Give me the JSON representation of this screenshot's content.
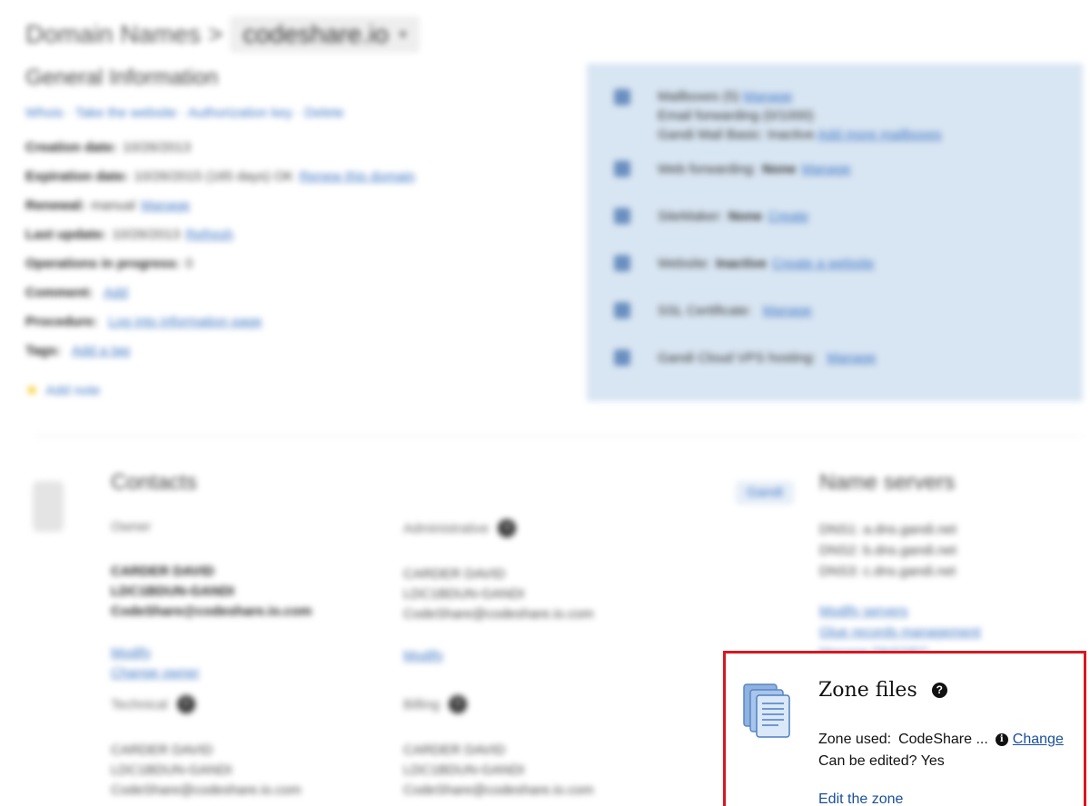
{
  "header": {
    "breadcrumb_root": "Domain Names",
    "breadcrumb_sep": ">",
    "domain": "codeshare.io"
  },
  "general": {
    "title": "General Information",
    "links": "Whois · Take the website · Authorization key · Delete",
    "rows": [
      {
        "key": "Creation date:",
        "value": "10/26/2013",
        "link": ""
      },
      {
        "key": "Expiration date:",
        "value": "10/26/2015 (165 days) OK",
        "link": "Renew this domain"
      },
      {
        "key": "Renewal:",
        "value": "manual",
        "link": "Manage"
      },
      {
        "key": "Last update:",
        "value": "10/26/2013",
        "link": "Refresh"
      },
      {
        "key": "Operations in progress:",
        "value": "0",
        "link": ""
      },
      {
        "key": "Comment:",
        "value": "",
        "link": "Add"
      },
      {
        "key": "Procedure:",
        "value": "",
        "link": "Log into information page"
      },
      {
        "key": "Tags:",
        "value": "",
        "link": "Add a tag"
      }
    ],
    "add_note": "Add note"
  },
  "services": [
    {
      "name": "Mailboxes (5)",
      "state": "",
      "link": "Manage",
      "line2": "Email forwarding (0/1000)",
      "line3": "Gandi Mail Basic: Inactive",
      "link2": "Add more mailboxes"
    },
    {
      "name": "Web forwarding:",
      "state": "None",
      "link": "Manage"
    },
    {
      "name": "SiteMaker:",
      "state": "None",
      "link": "Create"
    },
    {
      "name": "Website:",
      "state": "Inactive",
      "link": "Create a website"
    },
    {
      "name": "SSL Certificate:",
      "state": "",
      "link": "Manage"
    },
    {
      "name": "Gandi Cloud VPS hosting:",
      "state": "",
      "link": "Manage"
    }
  ],
  "contacts": {
    "title": "Contacts",
    "owner": {
      "role": "Owner",
      "name": "CARDER DAVID",
      "handle": "LDC1BDUN-GANDI",
      "email": "CodeShare@codeshare.io.com",
      "links": [
        "Modify",
        "Change owner"
      ]
    },
    "admin": {
      "role": "Administrative",
      "name": "CARDER DAVID",
      "handle": "LDC1BDUN-GANDI",
      "email": "CodeShare@codeshare.io.com",
      "links": [
        "Modify"
      ]
    },
    "tech": {
      "role": "Technical",
      "name": "CARDER DAVID",
      "handle": "LDC1BDUN-GANDI",
      "email": "CodeShare@codeshare.io.com"
    },
    "billing": {
      "role": "Billing",
      "name": "CARDER DAVID",
      "handle": "LDC1BDUN-GANDI",
      "email": "CodeShare@codeshare.io.com"
    }
  },
  "nameservers": {
    "badge": "Gandi",
    "title": "Name servers",
    "servers": [
      "DNS1: a.dns.gandi.net",
      "DNS2: b.dns.gandi.net",
      "DNS3: c.dns.gandi.net"
    ],
    "links": [
      "Modify servers",
      "Glue records management",
      "Manage DNSSEC"
    ]
  },
  "zone": {
    "title": "Zone files",
    "help": "?",
    "used_label": "Zone used:",
    "used_value": "CodeShare ...",
    "info": "i",
    "change": "Change",
    "editable": "Can be edited? Yes",
    "edit_link": "Edit the zone"
  },
  "colors": {
    "highlight_border": "#d9171f",
    "link": "#1a4f9c",
    "services_bg": "#d8e5f2"
  }
}
